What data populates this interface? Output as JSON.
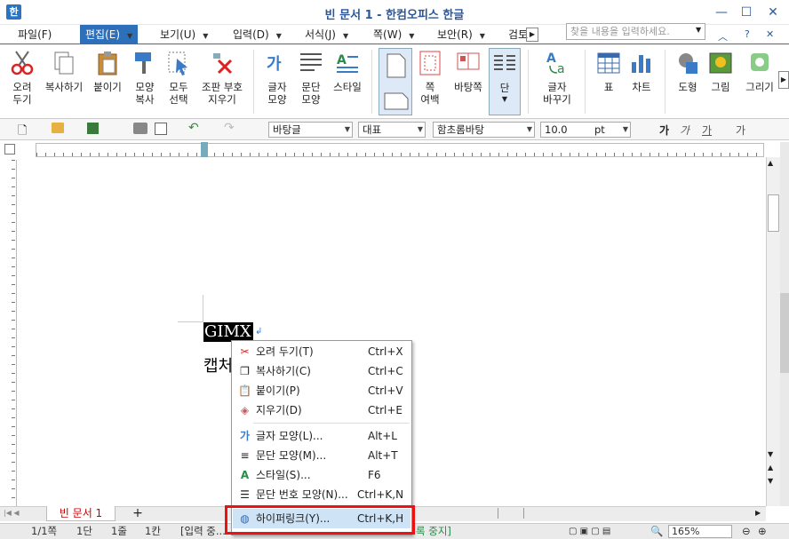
{
  "window": {
    "title": "빈 문서 1 - 한컴오피스 한글",
    "app_icon": "한",
    "minimize": "—",
    "maximize": "☐",
    "close": "✕"
  },
  "menus": [
    {
      "label": "파일(F)"
    },
    {
      "label": "편집(E)"
    },
    {
      "label": "보기(U)"
    },
    {
      "label": "입력(D)"
    },
    {
      "label": "서식(J)"
    },
    {
      "label": "쪽(W)"
    },
    {
      "label": "보안(R)"
    },
    {
      "label": "검토"
    }
  ],
  "search": {
    "placeholder": "찾을 내용을 입력하세요."
  },
  "ribbon": {
    "cut": "오려\n두기",
    "copy": "복사하기",
    "paste": "붙이기",
    "format_copy": "모양\n복사",
    "select_all": "모두\n선택",
    "clear_format": "조판 부호\n지우기",
    "char_shape": "글자\n모양",
    "para_shape": "문단\n모양",
    "style": "스타일",
    "page": "",
    "page_margin": "쪽\n여백",
    "master": "바탕쪽",
    "column": "단",
    "replace": "글자\n바꾸기",
    "table": "표",
    "chart": "차트",
    "shape": "도형",
    "picture": "그림",
    "drawing": "그리기"
  },
  "toolbar2": {
    "style_combo": "바탕글",
    "lang_combo": "대표",
    "font_combo": "함초롬바탕",
    "size_combo": "10.0",
    "unit": "pt",
    "bold": "가",
    "italic": "가",
    "underline": "가",
    "strike": "가"
  },
  "document": {
    "selected_text": "GIMX",
    "second_line": "캡처"
  },
  "context_menu": [
    {
      "label": "오려 두기(T)",
      "shortcut": "Ctrl+X",
      "icon": "scissors-icon"
    },
    {
      "label": "복사하기(C)",
      "shortcut": "Ctrl+C",
      "icon": "copy-icon"
    },
    {
      "label": "붙이기(P)",
      "shortcut": "Ctrl+V",
      "icon": "paste-icon"
    },
    {
      "label": "지우기(D)",
      "shortcut": "Ctrl+E",
      "icon": "eraser-icon"
    },
    {
      "label": "글자 모양(L)...",
      "shortcut": "Alt+L",
      "icon": "char-shape-icon"
    },
    {
      "label": "문단 모양(M)...",
      "shortcut": "Alt+T",
      "icon": "para-shape-icon"
    },
    {
      "label": "스타일(S)...",
      "shortcut": "F6",
      "icon": "style-icon"
    },
    {
      "label": "문단 번호 모양(N)...",
      "shortcut": "Ctrl+K,N",
      "icon": "numbering-icon"
    },
    {
      "label": "하이퍼링크(Y)...",
      "shortcut": "Ctrl+K,H",
      "icon": "globe-icon"
    }
  ],
  "tabs": {
    "doc_tab": "빈 문서 1",
    "add": "+"
  },
  "status": {
    "page": "1/1쪽",
    "column": "1단",
    "line": "1줄",
    "col": "1칸",
    "mode": "[입력 중...",
    "record": "록 중지]",
    "zoom": "165%"
  },
  "colors": {
    "accent": "#2d6fb8",
    "highlight": "#e11",
    "menu_hover": "#cfe3f7"
  }
}
